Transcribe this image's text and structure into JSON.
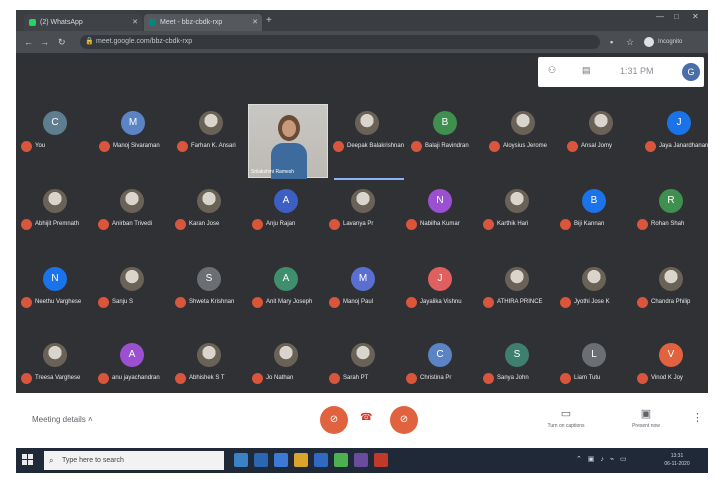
{
  "browser": {
    "tabs": [
      {
        "label": "(2) WhatsApp",
        "favicon_color": "#25d366"
      },
      {
        "label": "Meet - bbz-cbdk-rxp",
        "favicon_color": "#00897b"
      }
    ],
    "url": "meet.google.com/bbz-cbdk-rxp",
    "profile_label": "Incognito"
  },
  "meet": {
    "clock": "1:31 PM",
    "self_initial": "G",
    "featured_name": "Srilakshmi Ramesh",
    "participants": [
      {
        "name": "You",
        "initial": "C",
        "color": "#5f7d91"
      },
      {
        "name": "Manoj Sivaraman",
        "initial": "M",
        "color": "#5b84c4"
      },
      {
        "name": "Farhan K. Ansari",
        "initial": "",
        "color": "photo"
      },
      {
        "name": "Deepak Balakrishnan",
        "initial": "",
        "color": "photo"
      },
      {
        "name": "Balaji Ravindran",
        "initial": "B",
        "color": "#3f8f4f"
      },
      {
        "name": "Aloysius Jerome",
        "initial": "",
        "color": "photo"
      },
      {
        "name": "Ansal Jomy",
        "initial": "",
        "color": "photo"
      },
      {
        "name": "Jaya Janardhanan",
        "initial": "J",
        "color": "#1a73e8"
      },
      {
        "name": "Abhijit Premnath",
        "initial": "",
        "color": "photo"
      },
      {
        "name": "Anirban Trivedi",
        "initial": "",
        "color": "photo"
      },
      {
        "name": "Karan Jose",
        "initial": "",
        "color": "photo"
      },
      {
        "name": "Anju Rajan",
        "initial": "A",
        "color": "#3d5fc4"
      },
      {
        "name": "Lavanya Pr",
        "initial": "",
        "color": "photo"
      },
      {
        "name": "Nabilha Kumar",
        "initial": "N",
        "color": "#9b4fd1"
      },
      {
        "name": "Karthik Hari",
        "initial": "",
        "color": "photo"
      },
      {
        "name": "Biji Kannan",
        "initial": "B",
        "color": "#1a73e8"
      },
      {
        "name": "Rohan Shah",
        "initial": "R",
        "color": "#3f8f4f"
      },
      {
        "name": "Neethu Varghese",
        "initial": "N",
        "color": "#1a73e8"
      },
      {
        "name": "Sanju S",
        "initial": "",
        "color": "photo"
      },
      {
        "name": "Shweta Krishnan",
        "initial": "S",
        "color": "#6b6f73"
      },
      {
        "name": "Anit Mary Joseph",
        "initial": "A",
        "color": "#3f8f6f"
      },
      {
        "name": "Manoj Paul",
        "initial": "M",
        "color": "#5b6fd1"
      },
      {
        "name": "Jayalika Vishnu",
        "initial": "J",
        "color": "#e06060"
      },
      {
        "name": "ATHIRA PRINCE",
        "initial": "",
        "color": "photo"
      },
      {
        "name": "Jyothi Jose K",
        "initial": "",
        "color": "photo"
      },
      {
        "name": "Chandra Philip",
        "initial": "",
        "color": "photo"
      },
      {
        "name": "Treesa Varghese",
        "initial": "",
        "color": "photo"
      },
      {
        "name": "anu jayachandran",
        "initial": "A",
        "color": "#9b4fd1"
      },
      {
        "name": "Abhishek S T",
        "initial": "",
        "color": "photo"
      },
      {
        "name": "Jo Nathan",
        "initial": "",
        "color": "photo"
      },
      {
        "name": "Sarah PT",
        "initial": "",
        "color": "photo"
      },
      {
        "name": "Christina Pr",
        "initial": "C",
        "color": "#5b84c4"
      },
      {
        "name": "Sanya John",
        "initial": "S",
        "color": "#3f7f6f"
      },
      {
        "name": "Liam Tutu",
        "initial": "L",
        "color": "#6b6f73"
      },
      {
        "name": "Vinod K Joy",
        "initial": "V",
        "color": "#e0623f"
      }
    ]
  },
  "bottombar": {
    "meeting_details": "Meeting details",
    "captions_label": "Turn on captions",
    "present_label": "Present now"
  },
  "taskbar": {
    "search_placeholder": "Type here to search",
    "time": "13:31",
    "date": "06-11-2020"
  }
}
